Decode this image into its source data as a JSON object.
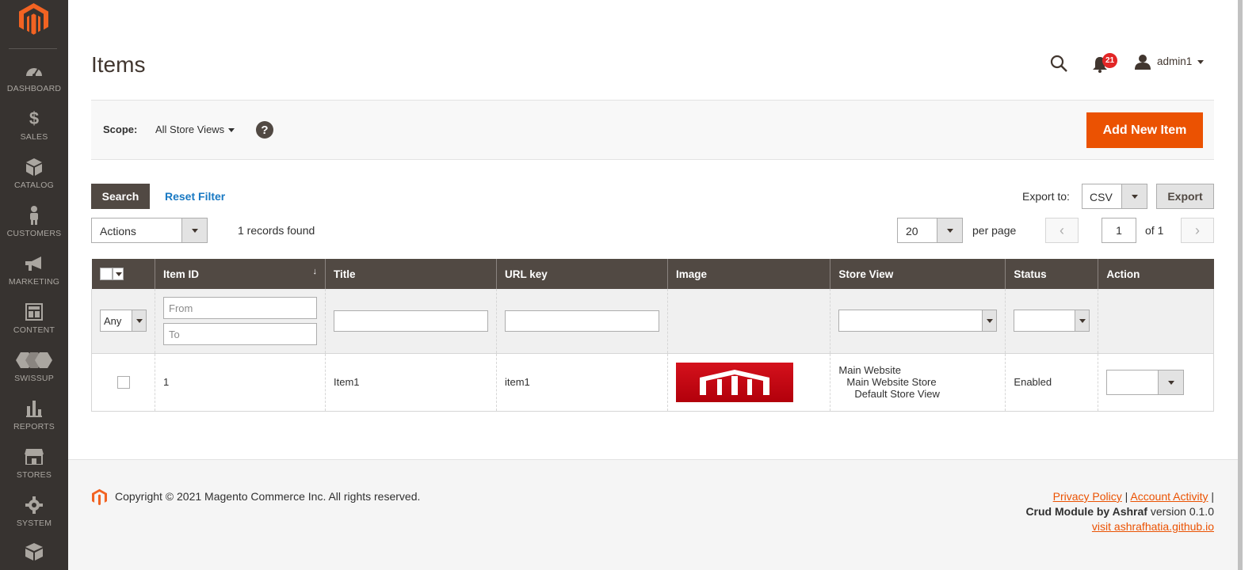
{
  "sidebar": {
    "items": [
      {
        "label": "DASHBOARD",
        "icon": "dashboard-icon"
      },
      {
        "label": "SALES",
        "icon": "dollar-icon"
      },
      {
        "label": "CATALOG",
        "icon": "catalog-box-icon"
      },
      {
        "label": "CUSTOMERS",
        "icon": "customer-person-icon"
      },
      {
        "label": "MARKETING",
        "icon": "megaphone-icon"
      },
      {
        "label": "CONTENT",
        "icon": "content-layout-icon"
      },
      {
        "label": "SWISSUP",
        "icon": "swissup-icon"
      },
      {
        "label": "REPORTS",
        "icon": "bar-chart-icon"
      },
      {
        "label": "STORES",
        "icon": "store-icon"
      },
      {
        "label": "SYSTEM",
        "icon": "gear-icon"
      }
    ]
  },
  "header": {
    "title": "Items",
    "notification_count": "21",
    "user": "admin1"
  },
  "scope": {
    "label": "Scope:",
    "value": "All Store Views",
    "help": "?",
    "add_button": "Add New Item"
  },
  "grid": {
    "search_button": "Search",
    "reset_filter": "Reset Filter",
    "export_label": "Export to:",
    "export_format": "CSV",
    "export_button": "Export",
    "actions": "Actions",
    "records_found": "1 records found",
    "per_page_value": "20",
    "per_page_label": "per page",
    "page_prev": "‹",
    "page_next": "›",
    "page_current": "1",
    "page_of": "of 1",
    "columns": [
      "Item ID",
      "Title",
      "URL key",
      "Image",
      "Store View",
      "Status",
      "Action"
    ],
    "sort_indicator": "↓",
    "filters": {
      "any": "Any",
      "from_placeholder": "From",
      "to_placeholder": "To"
    },
    "rows": [
      {
        "id": "1",
        "title": "Item1",
        "url_key": "item1",
        "store_view": [
          "Main Website",
          "Main Website Store",
          "Default Store View"
        ],
        "status": "Enabled"
      }
    ]
  },
  "footer": {
    "copyright": "Copyright © 2021 Magento Commerce Inc. All rights reserved.",
    "privacy": "Privacy Policy",
    "account_activity": "Account Activity",
    "module_name": "Crud Module by Ashraf",
    "version": "version 0.1.0",
    "visit_link": "visit ashrafhatia.github.io"
  },
  "colors": {
    "sidebar_bg": "#373330",
    "accent": "#eb5202",
    "table_header": "#514943",
    "badge": "#e22626",
    "link": "#1979c3"
  }
}
